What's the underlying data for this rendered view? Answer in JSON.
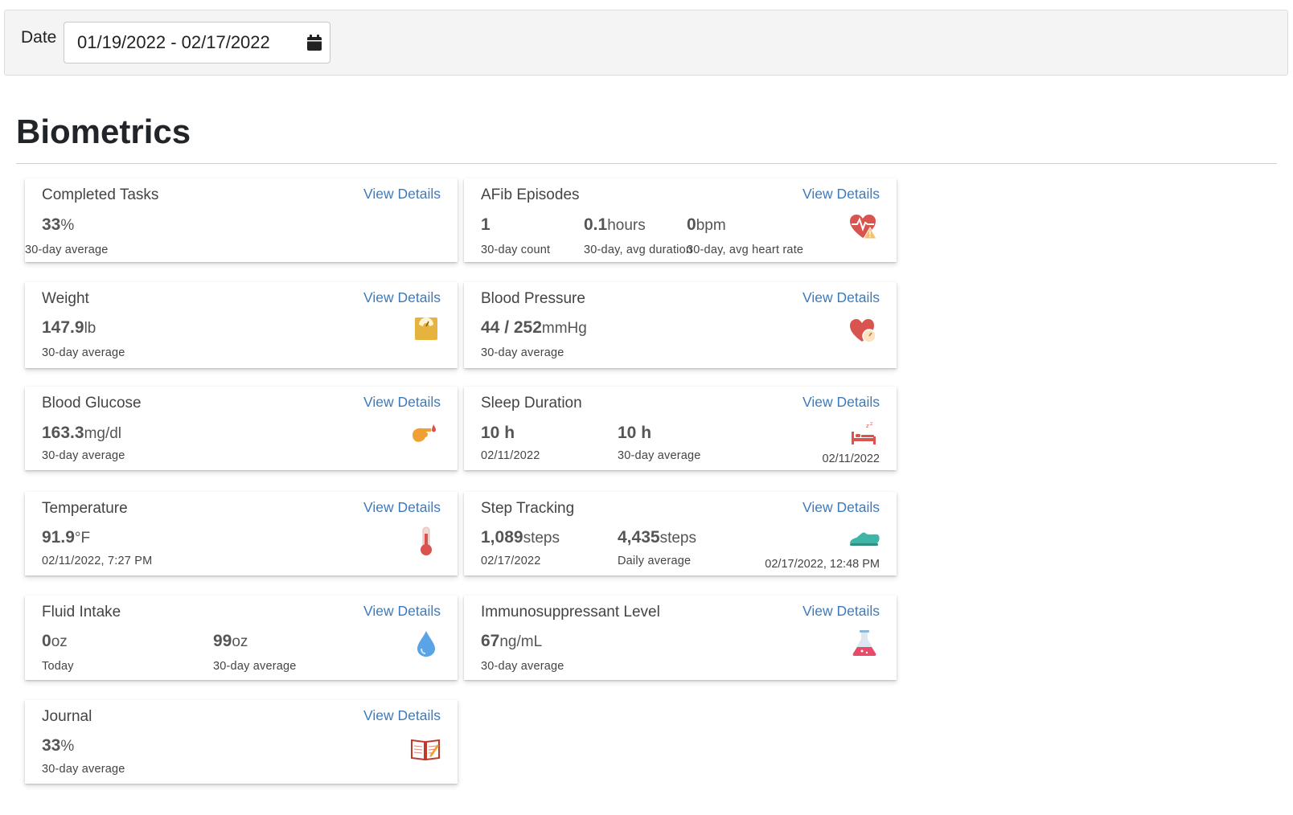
{
  "filter": {
    "label": "Date",
    "date_range": "01/19/2022 - 02/17/2022",
    "icon": "calendar-icon"
  },
  "page_title": "Biometrics",
  "view_details_label": "View Details",
  "cards": {
    "completed_tasks": {
      "title": "Completed Tasks",
      "value": "33",
      "unit": "%",
      "sub": "30-day average"
    },
    "afib": {
      "title": "AFib Episodes",
      "count": "1",
      "count_sub": "30-day count",
      "duration": "0.1",
      "duration_unit": "hours",
      "duration_sub": "30-day, avg duration",
      "hr": "0",
      "hr_unit": "bpm",
      "hr_sub": "30-day, avg heart rate",
      "icon": "heart-warning-icon"
    },
    "weight": {
      "title": "Weight",
      "value": "147.9",
      "unit": "lb",
      "sub": "30-day average",
      "icon": "scale-icon"
    },
    "blood_pressure": {
      "title": "Blood Pressure",
      "value": "44 / 252",
      "unit": "mmHg",
      "sub": "30-day average",
      "icon": "heart-gauge-icon"
    },
    "blood_glucose": {
      "title": "Blood Glucose",
      "value": "163.3",
      "unit": "mg/dl",
      "sub": "30-day average",
      "icon": "finger-drop-icon"
    },
    "sleep": {
      "title": "Sleep Duration",
      "value1": "10 h",
      "sub1": "02/11/2022",
      "value2": "10 h",
      "sub2": "30-day average",
      "date": "02/11/2022",
      "icon": "bed-icon"
    },
    "temperature": {
      "title": "Temperature",
      "value": "91.9",
      "unit": "°F",
      "sub": "02/11/2022, 7:27 PM",
      "icon": "thermometer-icon"
    },
    "steps": {
      "title": "Step Tracking",
      "value1": "1,089",
      "unit1": "steps",
      "sub1": "02/17/2022",
      "value2": "4,435",
      "unit2": "steps",
      "sub2": "Daily average",
      "date": "02/17/2022, 12:48 PM",
      "icon": "shoe-icon"
    },
    "fluid": {
      "title": "Fluid Intake",
      "value1": "0",
      "unit1": "oz",
      "sub1": "Today",
      "value2": "99",
      "unit2": "oz",
      "sub2": "30-day average",
      "icon": "water-drop-icon"
    },
    "immuno": {
      "title": "Immunosuppressant Level",
      "value": "67",
      "unit": "ng/mL",
      "sub": "30-day average",
      "icon": "flask-icon"
    },
    "journal": {
      "title": "Journal",
      "value": "33",
      "unit": "%",
      "sub": "30-day average",
      "icon": "book-icon"
    }
  },
  "colors": {
    "link": "#3d7ab8",
    "heading": "#212529"
  }
}
